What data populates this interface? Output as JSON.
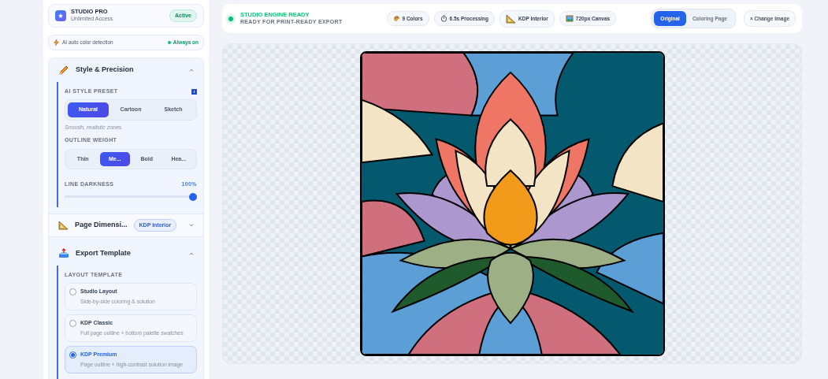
{
  "plan": {
    "name": "STUDIO PRO",
    "subtitle": "Unlimited Access",
    "badge": "Active"
  },
  "feature": {
    "label": "AI auto color detection",
    "status": "Always on",
    "on": true
  },
  "sections": [
    {
      "kind": "style",
      "title": "Style & Precision",
      "expanded": true,
      "preset": {
        "label": "AI STYLE PRESET",
        "options": [
          {
            "label": "Natural",
            "selected": true
          },
          {
            "label": "Cartoon",
            "selected": false
          },
          {
            "label": "Sketch",
            "selected": false
          }
        ],
        "hint": "Smooth, realistic zones"
      },
      "outline": {
        "label": "OUTLINE WEIGHT",
        "options": [
          {
            "label": "Thin",
            "selected": false
          },
          {
            "label": "Me...",
            "selected": true
          },
          {
            "label": "Bold",
            "selected": false
          },
          {
            "label": "Hea...",
            "selected": false
          }
        ]
      },
      "darkness": {
        "label": "LINE DARKNESS",
        "reading": "100%",
        "level": 1
      }
    },
    {
      "kind": "page",
      "title": "Page Dimensi...",
      "badge": "KDP Interior",
      "expanded": false
    },
    {
      "kind": "export",
      "title": "Export Template",
      "expanded": true,
      "layout": {
        "label": "LAYOUT TEMPLATE",
        "options": [
          {
            "title": "Studio Layout",
            "description": "Side-by-side coloring & solution",
            "selected": false
          },
          {
            "title": "KDP Classic",
            "description": "Full page outline + bottom palette swatches",
            "selected": false
          },
          {
            "title": "KDP Premium",
            "description": "Page outline + high-contrast solution image",
            "selected": true
          }
        ]
      }
    }
  ],
  "header": {
    "status": {
      "title": "STUDIO ENGINE READY",
      "subtitle": "READY FOR PRINT-READY EXPORT"
    },
    "stats": [
      {
        "label": "9 Colors"
      },
      {
        "label": "6.5s Processing"
      },
      {
        "label": "KDP Interior"
      },
      {
        "label": "720px Canvas"
      }
    ],
    "views": [
      {
        "label": "Original",
        "selected": true
      },
      {
        "label": "Coloring Page",
        "selected": false
      }
    ],
    "change_button": "× Change Image"
  }
}
